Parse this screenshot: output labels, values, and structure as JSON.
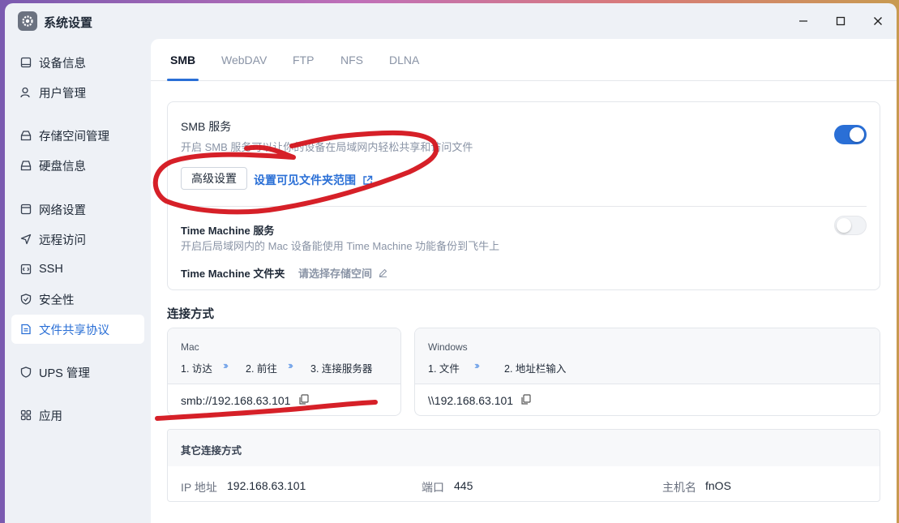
{
  "window": {
    "title": "系统设置"
  },
  "sidebar": {
    "items": [
      {
        "label": "设备信息",
        "icon": "device-icon"
      },
      {
        "label": "用户管理",
        "icon": "user-icon"
      },
      {
        "label": "存储空间管理",
        "icon": "storage-icon"
      },
      {
        "label": "硬盘信息",
        "icon": "disk-icon"
      },
      {
        "label": "网络设置",
        "icon": "network-icon"
      },
      {
        "label": "远程访问",
        "icon": "send-icon"
      },
      {
        "label": "SSH",
        "icon": "code-icon"
      },
      {
        "label": "安全性",
        "icon": "shield-check-icon"
      },
      {
        "label": "文件共享协议",
        "icon": "file-icon",
        "active": true
      },
      {
        "label": "UPS 管理",
        "icon": "shield-icon"
      },
      {
        "label": "应用",
        "icon": "apps-icon"
      }
    ]
  },
  "tabs": [
    {
      "label": "SMB",
      "active": true
    },
    {
      "label": "WebDAV"
    },
    {
      "label": "FTP"
    },
    {
      "label": "NFS"
    },
    {
      "label": "DLNA"
    }
  ],
  "smb": {
    "title": "SMB 服务",
    "desc": "开启 SMB 服务可以让你的设备在局域网内轻松共享和访问文件",
    "enabled": true,
    "advanced_button": "高级设置",
    "visible_scope_link": "设置可见文件夹范围"
  },
  "time_machine": {
    "title": "Time Machine 服务",
    "desc": "开启后局域网内的 Mac 设备能使用 Time Machine 功能备份到飞牛上",
    "enabled": false,
    "folder_label": "Time Machine 文件夹",
    "folder_placeholder": "请选择存储空间"
  },
  "connection": {
    "title": "连接方式",
    "mac": {
      "os": "Mac",
      "steps": [
        "1. 访达",
        "2. 前往",
        "3. 连接服务器"
      ],
      "address": "smb://192.168.63.101"
    },
    "windows": {
      "os": "Windows",
      "steps": [
        "1. 文件",
        "2. 地址栏输入"
      ],
      "address": "\\\\192.168.63.101"
    },
    "other": {
      "title": "其它连接方式",
      "ip_label": "IP 地址",
      "ip_value": "192.168.63.101",
      "port_label": "端口",
      "port_value": "445",
      "host_label": "主机名",
      "host_value": "fnOS"
    }
  },
  "arrow_glyph": "›››",
  "colors": {
    "accent": "#2a6fd6",
    "annotation": "#d4141c"
  }
}
